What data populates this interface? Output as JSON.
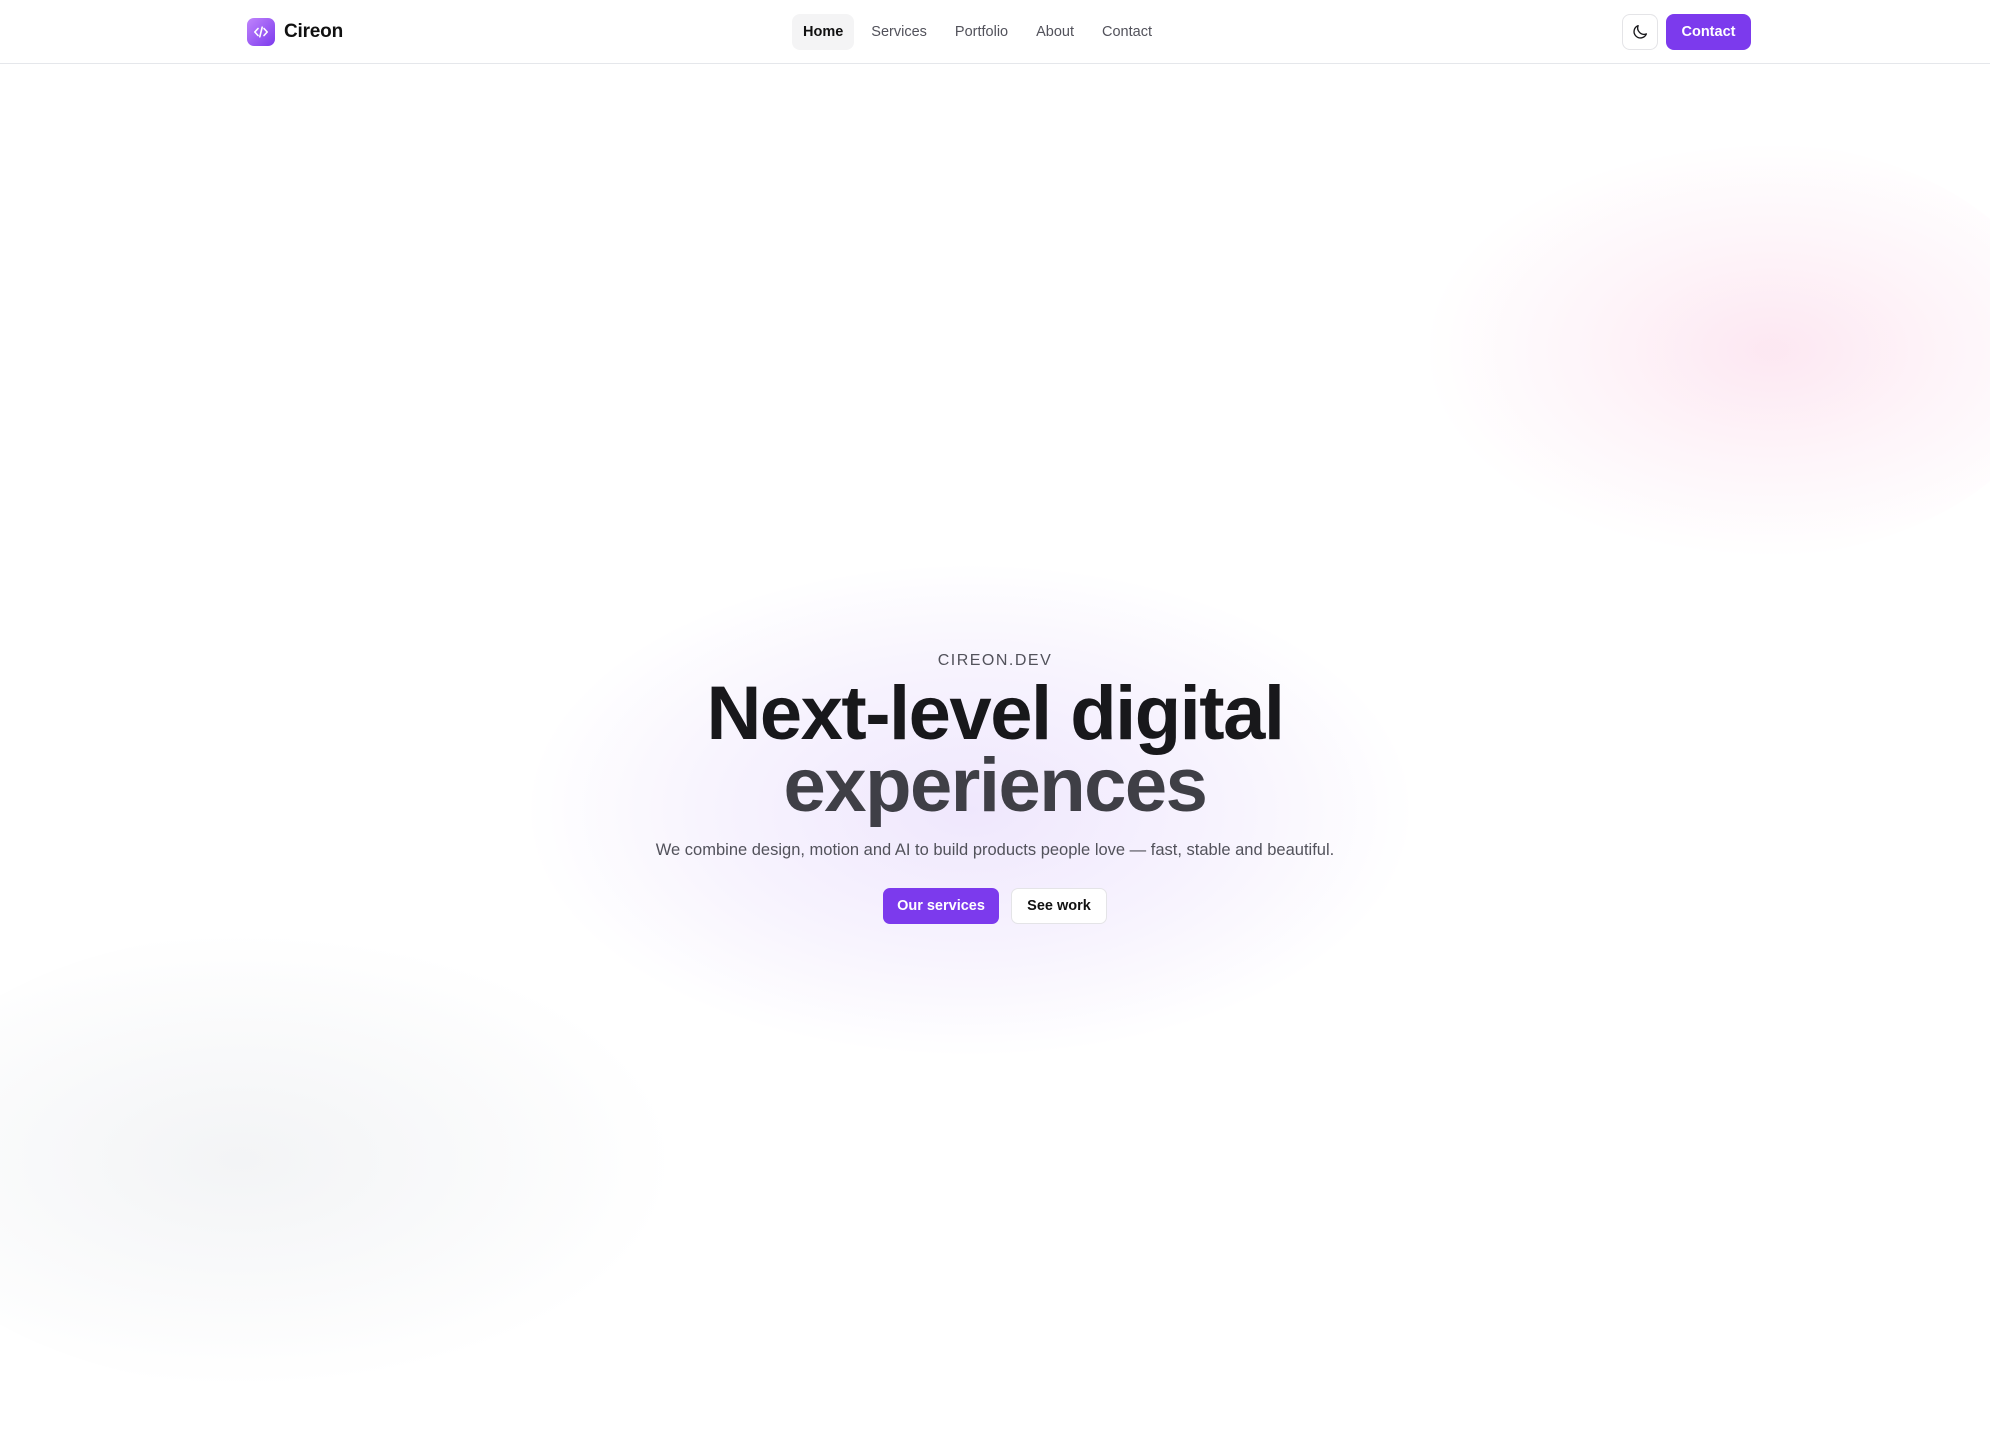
{
  "brand": {
    "name": "Cireon",
    "icon": "code-icon"
  },
  "nav": {
    "items": [
      {
        "label": "Home",
        "active": true
      },
      {
        "label": "Services",
        "active": false
      },
      {
        "label": "Portfolio",
        "active": false
      },
      {
        "label": "About",
        "active": false
      },
      {
        "label": "Contact",
        "active": false
      }
    ]
  },
  "header_actions": {
    "theme_toggle_icon": "moon-icon",
    "contact_label": "Contact"
  },
  "hero": {
    "eyebrow": "CIREON.DEV",
    "headline_line1": "Next-level digital",
    "headline_line2": "experiences",
    "subtitle": "We combine design, motion and AI to build products people love — fast, stable and beautiful.",
    "primary_cta": "Our services",
    "secondary_cta": "See work"
  },
  "colors": {
    "accent": "#7c3aed",
    "text": "#18181b",
    "muted": "#52525b",
    "border": "#e4e4e7"
  }
}
